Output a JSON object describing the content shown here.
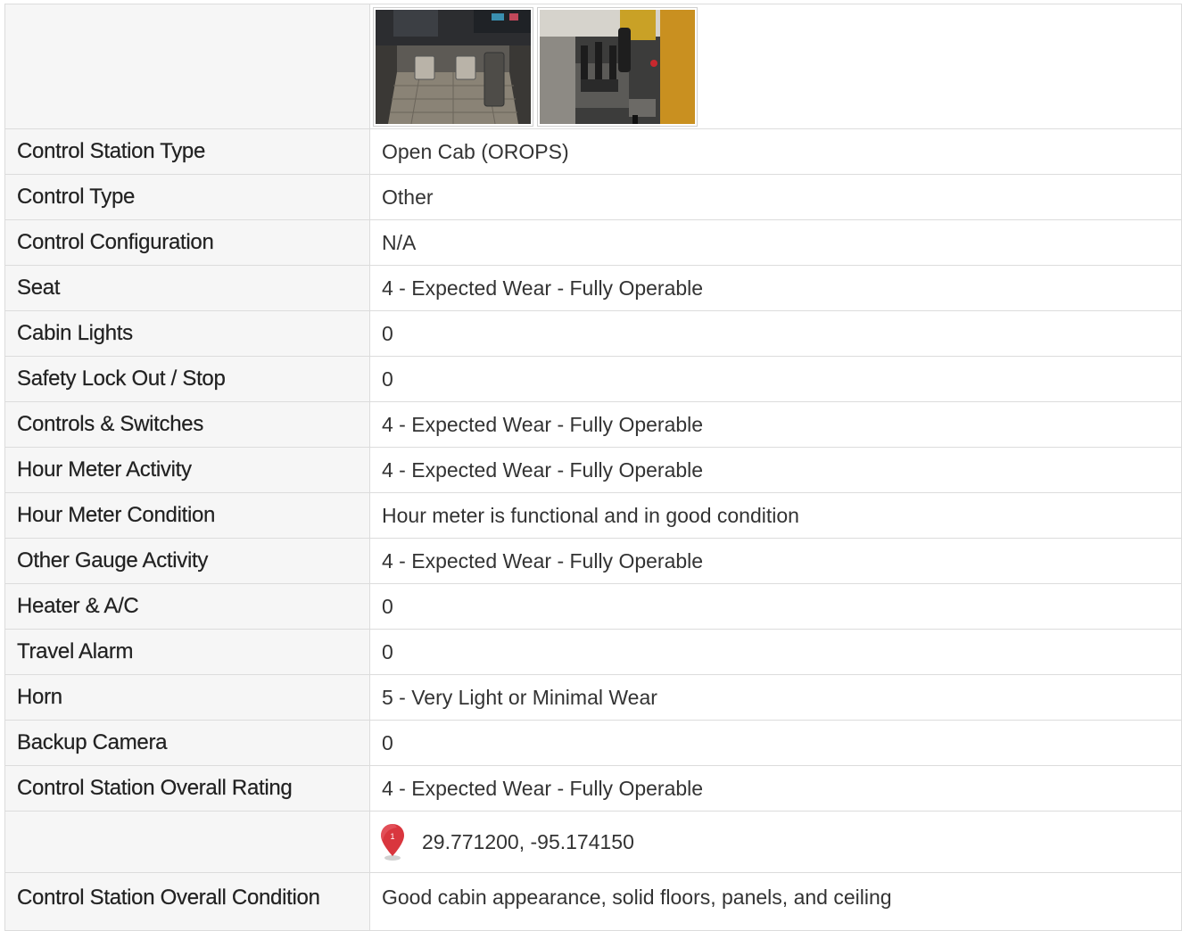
{
  "photos": [
    {
      "icon": "photo-cab-floor-pedals"
    },
    {
      "icon": "photo-cab-joystick-levers"
    }
  ],
  "rows": [
    {
      "label": "Control Station Type",
      "value": "Open Cab (OROPS)"
    },
    {
      "label": "Control Type",
      "value": "Other"
    },
    {
      "label": "Control Configuration",
      "value": "N/A"
    },
    {
      "label": "Seat",
      "value": "4 - Expected Wear - Fully Operable"
    },
    {
      "label": "Cabin Lights",
      "value": "0"
    },
    {
      "label": "Safety Lock Out / Stop",
      "value": "0"
    },
    {
      "label": "Controls & Switches",
      "value": "4 - Expected Wear - Fully Operable"
    },
    {
      "label": "Hour Meter Activity",
      "value": "4 - Expected Wear - Fully Operable"
    },
    {
      "label": "Hour Meter Condition",
      "value": "Hour meter is functional and in good condition"
    },
    {
      "label": "Other Gauge Activity",
      "value": "4 - Expected Wear - Fully Operable"
    },
    {
      "label": "Heater & A/C",
      "value": "0"
    },
    {
      "label": "Travel Alarm",
      "value": "0"
    },
    {
      "label": "Horn",
      "value": "5 - Very Light or Minimal Wear"
    },
    {
      "label": "Backup Camera",
      "value": "0"
    },
    {
      "label": "Control Station Overall Rating",
      "value": "4 - Expected Wear - Fully Operable"
    }
  ],
  "location": {
    "marker_icon": "map-pin-icon",
    "marker_number": "1",
    "coordinates": "29.771200, -95.174150",
    "marker_color": "#d9363e"
  },
  "last_row": {
    "label": "Control Station Overall Condition",
    "value": "Good cabin appearance, solid floors, panels, and ceiling"
  }
}
